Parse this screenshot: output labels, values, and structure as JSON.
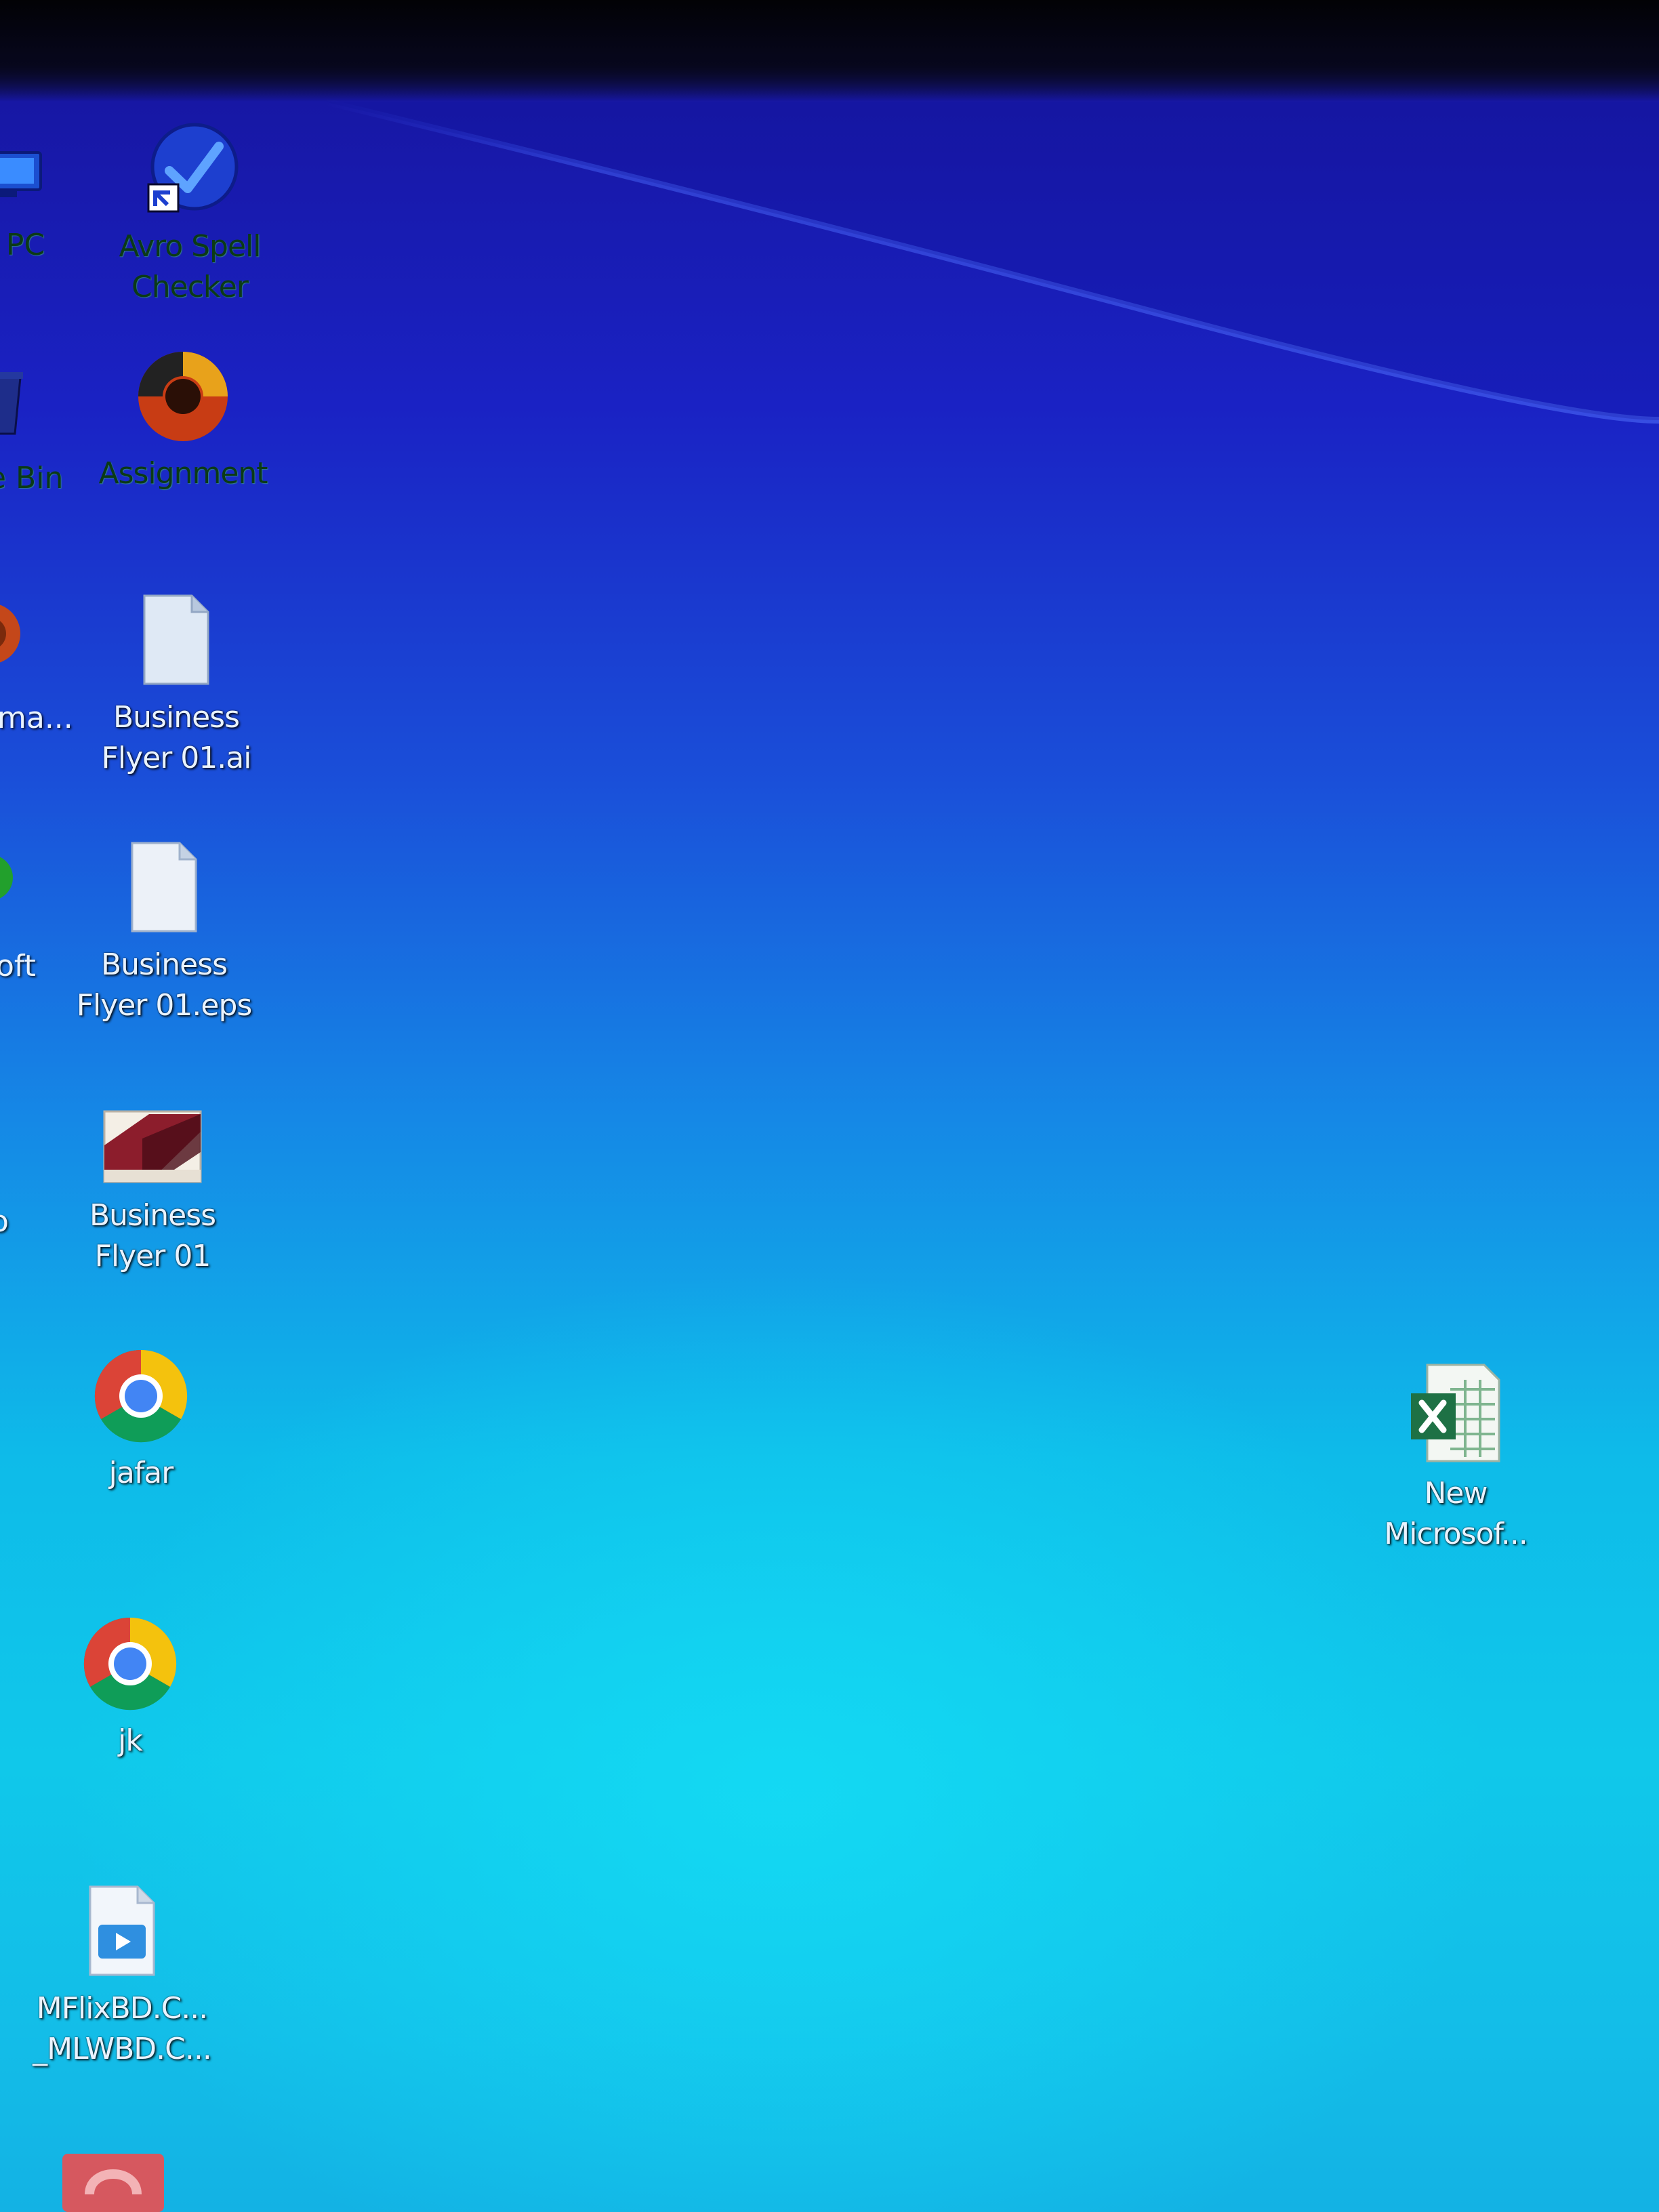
{
  "desktop": {
    "left_column": [
      {
        "id": "this-pc",
        "label_partial": "s PC",
        "icon": "this-pc-icon"
      },
      {
        "id": "recycle-bin",
        "label_partial": "e Bin",
        "icon": "recycle-bin-icon"
      },
      {
        "id": "illustrator-partial",
        "label_partial": "ma...",
        "icon": "app-icon"
      },
      {
        "id": "microsoft-partial",
        "label_partial": "oft",
        "icon": "app-icon"
      },
      {
        "id": "app-partial-o",
        "label_partial": "o",
        "icon": "app-icon"
      }
    ],
    "icons": [
      {
        "id": "avro-spell-checker",
        "label": "Avro Spell\nChecker",
        "icon": "spell-checker-icon"
      },
      {
        "id": "assignment",
        "label": "Assignment",
        "icon": "app-shortcut-icon"
      },
      {
        "id": "business-flyer-ai",
        "label": "Business\nFlyer 01.ai",
        "icon": "file-icon"
      },
      {
        "id": "business-flyer-eps",
        "label": "Business\nFlyer 01.eps",
        "icon": "file-icon"
      },
      {
        "id": "business-flyer-folder",
        "label": "Business\nFlyer 01",
        "icon": "folder-icon"
      },
      {
        "id": "jafar",
        "label": "jafar",
        "icon": "chrome-icon"
      },
      {
        "id": "jk",
        "label": "jk",
        "icon": "chrome-icon"
      },
      {
        "id": "mflixbd",
        "label": "MFlixBD.C...\n_MLWBD.C...",
        "icon": "video-file-icon"
      }
    ],
    "right_icon": {
      "id": "new-microsoft-excel",
      "label": "New\nMicrosof...",
      "icon": "excel-icon"
    },
    "colors": {
      "wallpaper_top": "#1717a4",
      "wallpaper_mid": "#1a4fd9",
      "wallpaper_bottom": "#10c8ea"
    }
  }
}
